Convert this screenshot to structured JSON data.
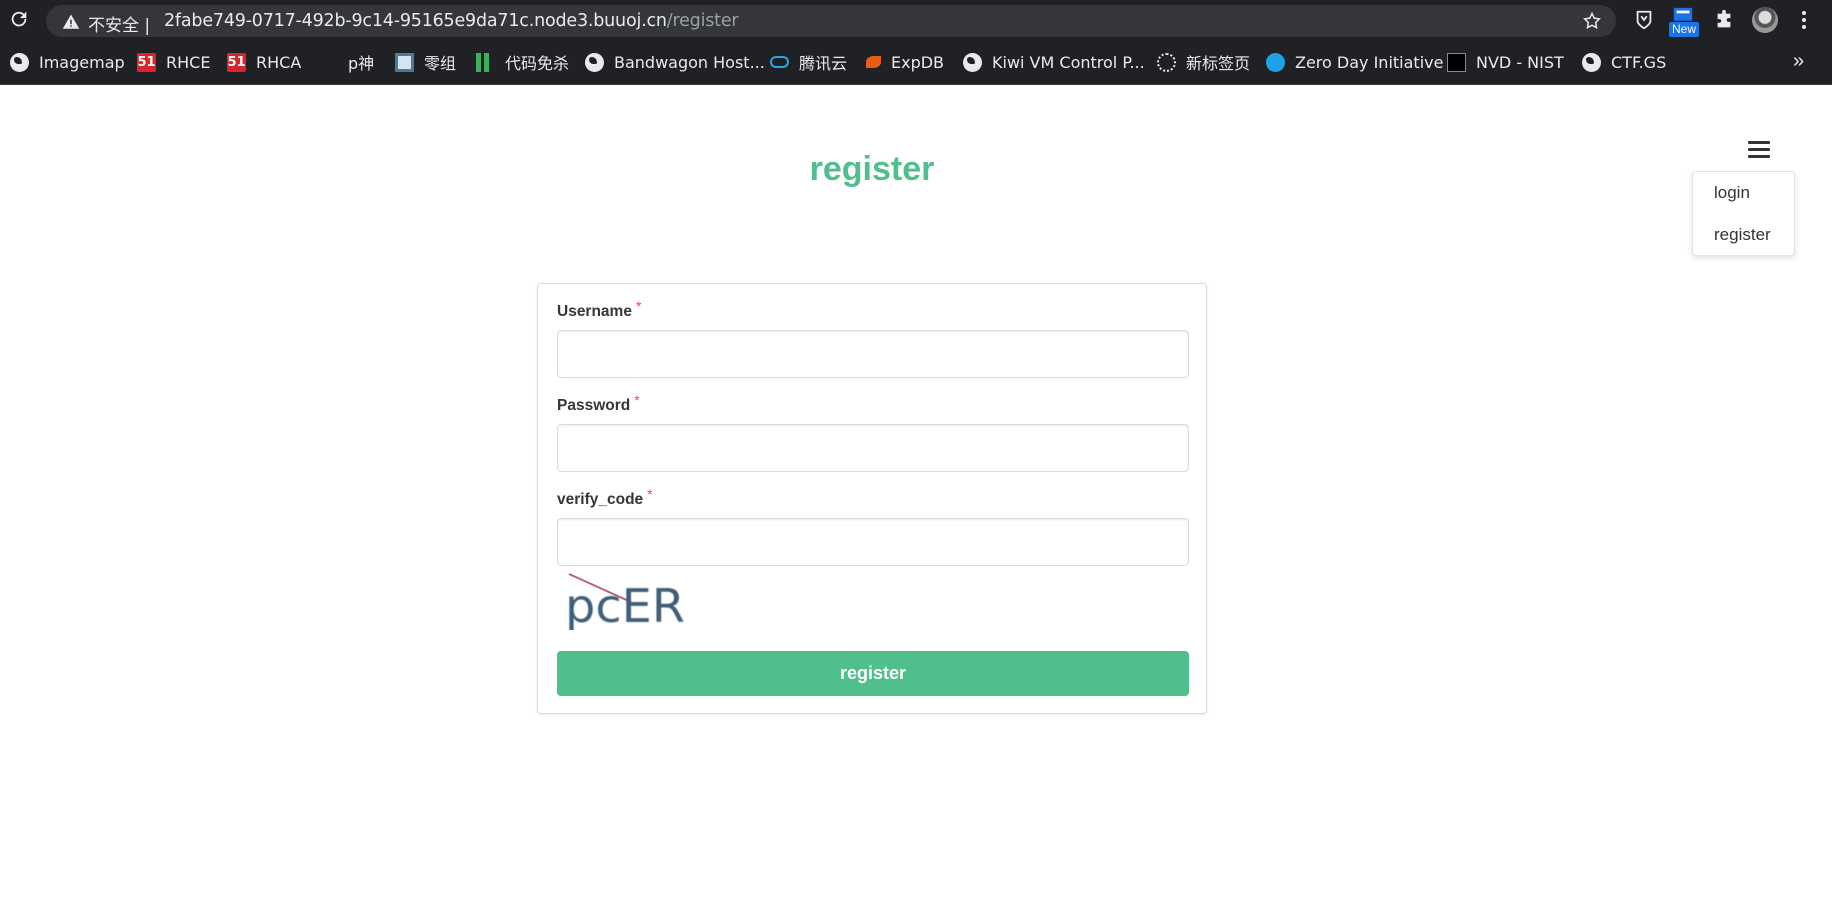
{
  "browser": {
    "security_label": "不安全",
    "url_host": "2fabe749-0717-492b-9c14-95165e9da71c.node3.buuoj.cn",
    "url_path": "/register",
    "new_badge": "New",
    "bookmarks": [
      {
        "label": "Imagemap",
        "icon": "globe-icon"
      },
      {
        "label": "RHCE",
        "icon": "51cto-icon",
        "badge": "51"
      },
      {
        "label": "RHCA",
        "icon": "51cto-icon",
        "badge": "51"
      },
      {
        "label": "p神",
        "icon": "blank-icon"
      },
      {
        "label": "零组",
        "icon": "lingzu-icon"
      },
      {
        "label": "代码免杀",
        "icon": "green-bars-icon"
      },
      {
        "label": "Bandwagon Host...",
        "icon": "globe-icon"
      },
      {
        "label": "腾讯云",
        "icon": "tencent-cloud-icon"
      },
      {
        "label": "ExpDB",
        "icon": "expdb-icon"
      },
      {
        "label": "Kiwi VM Control P...",
        "icon": "globe-icon"
      },
      {
        "label": "新标签页",
        "icon": "grid-icon"
      },
      {
        "label": "Zero Day Initiative",
        "icon": "zdi-icon"
      },
      {
        "label": "NVD - NIST",
        "icon": "nvd-icon"
      },
      {
        "label": "CTF.GS",
        "icon": "globe-icon"
      }
    ],
    "more_label": "»"
  },
  "page": {
    "title": "register",
    "menu": {
      "items": [
        "login",
        "register"
      ]
    }
  },
  "form": {
    "fields": [
      {
        "label": "Username",
        "required_mark": "*",
        "value": ""
      },
      {
        "label": "Password",
        "required_mark": "*",
        "value": ""
      },
      {
        "label": "verify_code",
        "required_mark": "*",
        "value": ""
      }
    ],
    "captcha_text": "pcER",
    "submit_label": "register"
  },
  "colors": {
    "accent": "#4fbf8b",
    "required": "#ff3860"
  }
}
